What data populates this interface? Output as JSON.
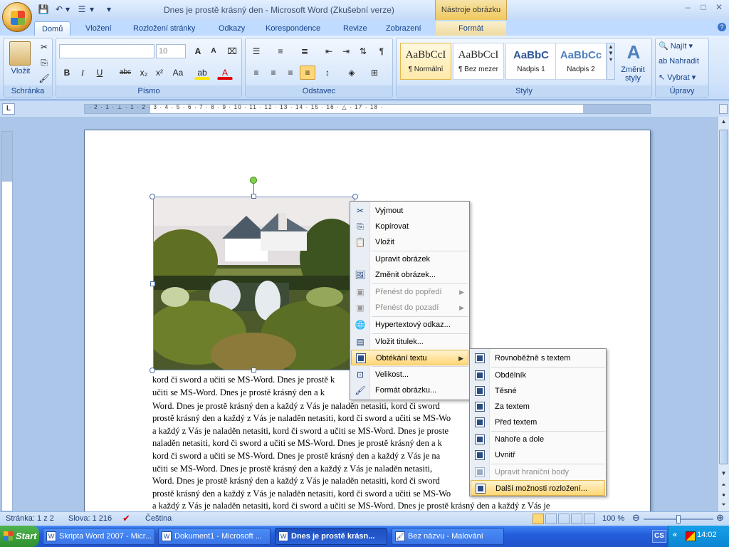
{
  "window": {
    "title": "Dnes je prostě krásný den - Microsoft Word (Zkušební verze)",
    "context_tab_title": "Nástroje obrázku",
    "min": "–",
    "max": "□",
    "close": "✕"
  },
  "qat": {
    "save": "💾",
    "undo": "↶",
    "list": "☰",
    "more": "▾"
  },
  "tabs": [
    "Domů",
    "Vložení",
    "Rozložení stránky",
    "Odkazy",
    "Korespondence",
    "Revize",
    "Zobrazení",
    "Formát"
  ],
  "ribbon": {
    "clipboard": {
      "paste_label": "Vložit",
      "group": "Schránka"
    },
    "font": {
      "family_value": "",
      "size_value": "10",
      "group": "Písmo",
      "bold": "B",
      "italic": "I",
      "underline": "U",
      "strike": "abc",
      "sub": "x₂",
      "sup": "x²",
      "case": "Aa"
    },
    "paragraph": {
      "group": "Odstavec",
      "pilcrow": "¶"
    },
    "styles": {
      "group": "Styly",
      "change_label": "Změnit styly",
      "items": [
        {
          "sample": "AaBbCcI",
          "name": "¶ Normální"
        },
        {
          "sample": "AaBbCcI",
          "name": "¶ Bez mezer"
        },
        {
          "sample": "AaBbC",
          "name": "Nadpis 1"
        },
        {
          "sample": "AaBbCc",
          "name": "Nadpis 2"
        }
      ]
    },
    "editing": {
      "group": "Úpravy",
      "find": "Najít",
      "replace": "Nahradit",
      "select": "Vybrat"
    }
  },
  "ruler": {
    "corner": "L",
    "numbers": "· 2 · 1 · ⊥ · 1 · 2 · 3 · 4 · 5 · 6 · 7 · 8 · 9 · 10 · 11 · 12 · 13 · 14 · 15 · 16 · △ · 17 · 18 ·"
  },
  "body_lines": [
    "kord či sword a učiti se MS-Word. Dnes je prostě k",
    "učiti se MS-Word. Dnes je prostě krásný den a k",
    "Word. Dnes je prostě krásný den a každý z Vás je naladěn netasiti, kord či sword",
    "prostě krásný den a každý z Vás je naladěn netasiti, kord či sword a učiti se MS-Wo",
    "a každý z Vás je naladěn netasiti, kord či sword a učiti se MS-Word. Dnes je proste",
    "naladěn netasiti, kord či sword a učiti se MS-Word. Dnes je prostě krásný den a k",
    "kord či sword a učiti se MS-Word. Dnes je prostě krásný den a každý z Vás je na",
    "učiti se MS-Word. Dnes je prostě krásný den a každý z Vás je naladěn netasiti,",
    "Word. Dnes je prostě krásný den a každý z Vás je naladěn netasiti, kord či sword",
    "prostě krásný den a každý z Vás je naladěn netasiti, kord či sword a učiti se MS-Wo",
    "a každý z Vás je naladěn netasiti, kord či sword a učiti se MS-Word. Dnes je prostě krásný den a každý z Vás je"
  ],
  "context_menu": {
    "items": [
      {
        "label": "Vyjmout",
        "icon": "✂",
        "disabled": false
      },
      {
        "label": "Kopírovat",
        "icon": "⎘",
        "disabled": false
      },
      {
        "label": "Vložit",
        "icon": "📋",
        "disabled": false
      },
      {
        "label": "Upravit obrázek",
        "icon": "",
        "disabled": false
      },
      {
        "label": "Změnit obrázek...",
        "icon": "🖼",
        "disabled": false
      },
      {
        "label": "Přenést do popředí",
        "icon": "▣",
        "disabled": true
      },
      {
        "label": "Přenést do pozadí",
        "icon": "▣",
        "disabled": true
      },
      {
        "label": "Hypertextový odkaz...",
        "icon": "🌐",
        "disabled": false
      },
      {
        "label": "Vložit titulek...",
        "icon": "▤",
        "disabled": false
      },
      {
        "label": "Obtékání textu",
        "icon": "",
        "disabled": false
      },
      {
        "label": "Velikost...",
        "icon": "⊡",
        "disabled": false
      },
      {
        "label": "Formát obrázku...",
        "icon": "🖌",
        "disabled": false
      }
    ]
  },
  "submenu": {
    "items": [
      {
        "label": "Rovnoběžně s textem",
        "disabled": false
      },
      {
        "label": "Obdélník",
        "disabled": false
      },
      {
        "label": "Těsné",
        "disabled": false
      },
      {
        "label": "Za textem",
        "disabled": false
      },
      {
        "label": "Před textem",
        "disabled": false
      },
      {
        "label": "Nahoře a dole",
        "disabled": false
      },
      {
        "label": "Uvnitř",
        "disabled": false
      },
      {
        "label": "Upravit hraniční body",
        "disabled": true
      },
      {
        "label": "Další možnosti rozložení...",
        "disabled": false
      }
    ]
  },
  "statusbar": {
    "page": "Stránka: 1 z 2",
    "words": "Slova: 1 216",
    "lang": "Čeština",
    "zoom": "100 %",
    "zoom_level": 1.0
  },
  "taskbar": {
    "start": "Start",
    "tasks": [
      {
        "label": "Skripta Word 2007 - Micr...",
        "active": false
      },
      {
        "label": "Dokument1 - Microsoft ...",
        "active": false
      },
      {
        "label": "Dnes je prostě krásn...",
        "active": true
      },
      {
        "label": "Bez názvu - Malování",
        "active": false
      }
    ],
    "lang": "CS",
    "time": "14:02"
  }
}
